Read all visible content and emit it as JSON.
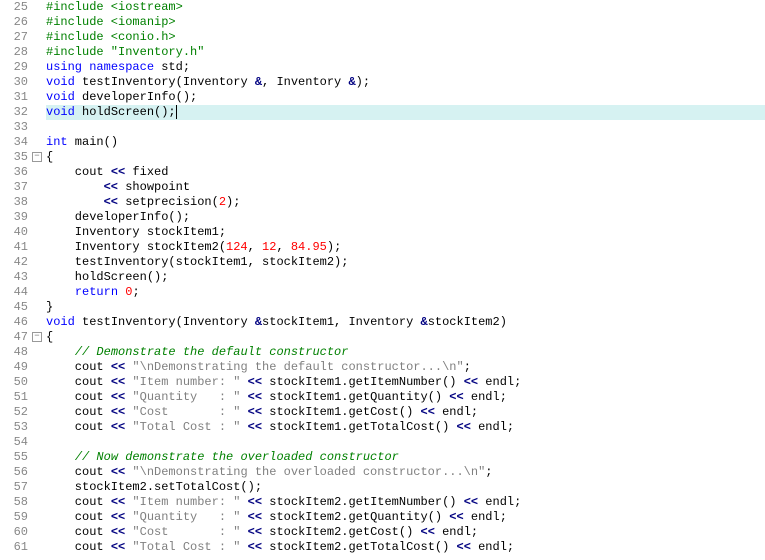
{
  "editor": {
    "first_line": 25,
    "highlight_line": 32,
    "lines": [
      [
        {
          "c": "pp",
          "t": "#include <iostream>"
        }
      ],
      [
        {
          "c": "pp",
          "t": "#include <iomanip>"
        }
      ],
      [
        {
          "c": "pp",
          "t": "#include <conio.h>"
        }
      ],
      [
        {
          "c": "pp",
          "t": "#include \"Inventory.h\""
        }
      ],
      [
        {
          "c": "kw",
          "t": "using"
        },
        {
          "t": " "
        },
        {
          "c": "kw",
          "t": "namespace"
        },
        {
          "t": " std;"
        }
      ],
      [
        {
          "c": "kw",
          "t": "void"
        },
        {
          "t": " testInventory(Inventory "
        },
        {
          "c": "op",
          "t": "&"
        },
        {
          "t": ", Inventory "
        },
        {
          "c": "op",
          "t": "&"
        },
        {
          "t": ");"
        }
      ],
      [
        {
          "c": "kw",
          "t": "void"
        },
        {
          "t": " developerInfo();"
        }
      ],
      [
        {
          "c": "kw",
          "t": "void"
        },
        {
          "t": " holdScreen();"
        }
      ],
      [
        {
          "t": ""
        }
      ],
      [
        {
          "c": "kw",
          "t": "int"
        },
        {
          "t": " main()"
        }
      ],
      [
        {
          "t": "{"
        }
      ],
      [
        {
          "t": "    cout "
        },
        {
          "c": "op",
          "t": "<<"
        },
        {
          "t": " fixed"
        }
      ],
      [
        {
          "t": "        "
        },
        {
          "c": "op",
          "t": "<<"
        },
        {
          "t": " showpoint"
        }
      ],
      [
        {
          "t": "        "
        },
        {
          "c": "op",
          "t": "<<"
        },
        {
          "t": " setprecision("
        },
        {
          "c": "num",
          "t": "2"
        },
        {
          "t": ");"
        }
      ],
      [
        {
          "t": "    developerInfo();"
        }
      ],
      [
        {
          "t": "    Inventory stockItem1;"
        }
      ],
      [
        {
          "t": "    Inventory stockItem2("
        },
        {
          "c": "num",
          "t": "124"
        },
        {
          "t": ", "
        },
        {
          "c": "num",
          "t": "12"
        },
        {
          "t": ", "
        },
        {
          "c": "num",
          "t": "84.95"
        },
        {
          "t": ");"
        }
      ],
      [
        {
          "t": "    testInventory(stockItem1, stockItem2);"
        }
      ],
      [
        {
          "t": "    holdScreen();"
        }
      ],
      [
        {
          "t": "    "
        },
        {
          "c": "kw",
          "t": "return"
        },
        {
          "t": " "
        },
        {
          "c": "num",
          "t": "0"
        },
        {
          "t": ";"
        }
      ],
      [
        {
          "t": "}"
        }
      ],
      [
        {
          "c": "kw",
          "t": "void"
        },
        {
          "t": " testInventory(Inventory "
        },
        {
          "c": "op",
          "t": "&"
        },
        {
          "t": "stockItem1, Inventory "
        },
        {
          "c": "op",
          "t": "&"
        },
        {
          "t": "stockItem2)"
        }
      ],
      [
        {
          "t": "{"
        }
      ],
      [
        {
          "t": "    "
        },
        {
          "c": "cm",
          "t": "// Demonstrate the default constructor"
        }
      ],
      [
        {
          "t": "    cout "
        },
        {
          "c": "op",
          "t": "<<"
        },
        {
          "t": " "
        },
        {
          "c": "str",
          "t": "\"\\nDemonstrating the default constructor...\\n\""
        },
        {
          "t": ";"
        }
      ],
      [
        {
          "t": "    cout "
        },
        {
          "c": "op",
          "t": "<<"
        },
        {
          "t": " "
        },
        {
          "c": "str",
          "t": "\"Item number: \""
        },
        {
          "t": " "
        },
        {
          "c": "op",
          "t": "<<"
        },
        {
          "t": " stockItem1.getItemNumber() "
        },
        {
          "c": "op",
          "t": "<<"
        },
        {
          "t": " endl;"
        }
      ],
      [
        {
          "t": "    cout "
        },
        {
          "c": "op",
          "t": "<<"
        },
        {
          "t": " "
        },
        {
          "c": "str",
          "t": "\"Quantity   : \""
        },
        {
          "t": " "
        },
        {
          "c": "op",
          "t": "<<"
        },
        {
          "t": " stockItem1.getQuantity() "
        },
        {
          "c": "op",
          "t": "<<"
        },
        {
          "t": " endl;"
        }
      ],
      [
        {
          "t": "    cout "
        },
        {
          "c": "op",
          "t": "<<"
        },
        {
          "t": " "
        },
        {
          "c": "str",
          "t": "\"Cost       : \""
        },
        {
          "t": " "
        },
        {
          "c": "op",
          "t": "<<"
        },
        {
          "t": " stockItem1.getCost() "
        },
        {
          "c": "op",
          "t": "<<"
        },
        {
          "t": " endl;"
        }
      ],
      [
        {
          "t": "    cout "
        },
        {
          "c": "op",
          "t": "<<"
        },
        {
          "t": " "
        },
        {
          "c": "str",
          "t": "\"Total Cost : \""
        },
        {
          "t": " "
        },
        {
          "c": "op",
          "t": "<<"
        },
        {
          "t": " stockItem1.getTotalCost() "
        },
        {
          "c": "op",
          "t": "<<"
        },
        {
          "t": " endl;"
        }
      ],
      [
        {
          "t": ""
        }
      ],
      [
        {
          "t": "    "
        },
        {
          "c": "cm",
          "t": "// Now demonstrate the overloaded constructor"
        }
      ],
      [
        {
          "t": "    cout "
        },
        {
          "c": "op",
          "t": "<<"
        },
        {
          "t": " "
        },
        {
          "c": "str",
          "t": "\"\\nDemonstrating the overloaded constructor...\\n\""
        },
        {
          "t": ";"
        }
      ],
      [
        {
          "t": "    stockItem2.setTotalCost();"
        }
      ],
      [
        {
          "t": "    cout "
        },
        {
          "c": "op",
          "t": "<<"
        },
        {
          "t": " "
        },
        {
          "c": "str",
          "t": "\"Item number: \""
        },
        {
          "t": " "
        },
        {
          "c": "op",
          "t": "<<"
        },
        {
          "t": " stockItem2.getItemNumber() "
        },
        {
          "c": "op",
          "t": "<<"
        },
        {
          "t": " endl;"
        }
      ],
      [
        {
          "t": "    cout "
        },
        {
          "c": "op",
          "t": "<<"
        },
        {
          "t": " "
        },
        {
          "c": "str",
          "t": "\"Quantity   : \""
        },
        {
          "t": " "
        },
        {
          "c": "op",
          "t": "<<"
        },
        {
          "t": " stockItem2.getQuantity() "
        },
        {
          "c": "op",
          "t": "<<"
        },
        {
          "t": " endl;"
        }
      ],
      [
        {
          "t": "    cout "
        },
        {
          "c": "op",
          "t": "<<"
        },
        {
          "t": " "
        },
        {
          "c": "str",
          "t": "\"Cost       : \""
        },
        {
          "t": " "
        },
        {
          "c": "op",
          "t": "<<"
        },
        {
          "t": " stockItem2.getCost() "
        },
        {
          "c": "op",
          "t": "<<"
        },
        {
          "t": " endl;"
        }
      ],
      [
        {
          "t": "    cout "
        },
        {
          "c": "op",
          "t": "<<"
        },
        {
          "t": " "
        },
        {
          "c": "str",
          "t": "\"Total Cost : \""
        },
        {
          "t": " "
        },
        {
          "c": "op",
          "t": "<<"
        },
        {
          "t": " stockItem2.getTotalCost() "
        },
        {
          "c": "op",
          "t": "<<"
        },
        {
          "t": " endl;"
        }
      ]
    ],
    "folds": {
      "35": "-",
      "47": "-"
    }
  }
}
